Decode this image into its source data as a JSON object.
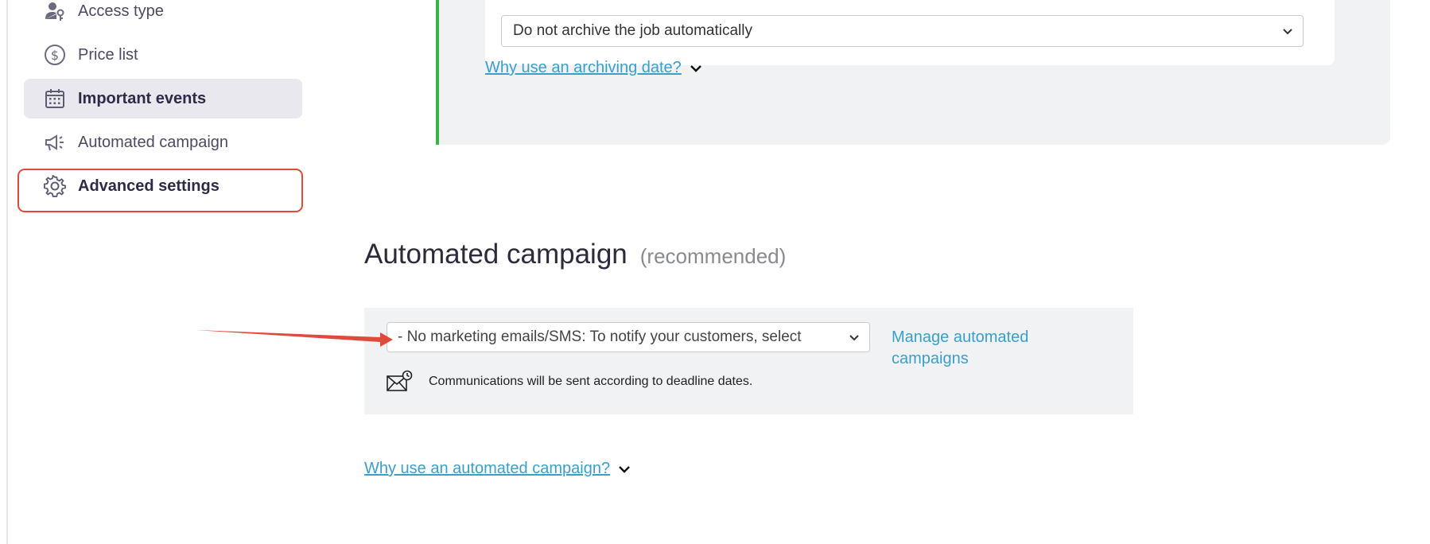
{
  "sidebar": {
    "items": [
      {
        "label": "Access type",
        "icon": "access-type-icon"
      },
      {
        "label": "Price list",
        "icon": "price-list-icon"
      },
      {
        "label": "Important events",
        "icon": "calendar-icon",
        "state": "active"
      },
      {
        "label": "Automated campaign",
        "icon": "megaphone-icon"
      },
      {
        "label": "Advanced settings",
        "icon": "gear-icon",
        "state": "highlighted"
      }
    ]
  },
  "archive": {
    "select_value": "Do not archive the job automatically",
    "help_link": "Why use an archiving date?"
  },
  "campaign": {
    "title": "Automated campaign",
    "subtitle": "(recommended)",
    "select_value": "- No marketing emails/SMS: To notify your customers, select",
    "manage_link": "Manage automated campaigns",
    "info_text": "Communications will be sent according to deadline dates.",
    "help_link": "Why use an automated campaign?"
  },
  "colors": {
    "accent_link": "#3a9fcc",
    "active_bg": "#e8e8ee",
    "highlight_border": "#e04a3a",
    "archive_accent": "#3db04a",
    "panel_bg": "#f1f2f4"
  }
}
